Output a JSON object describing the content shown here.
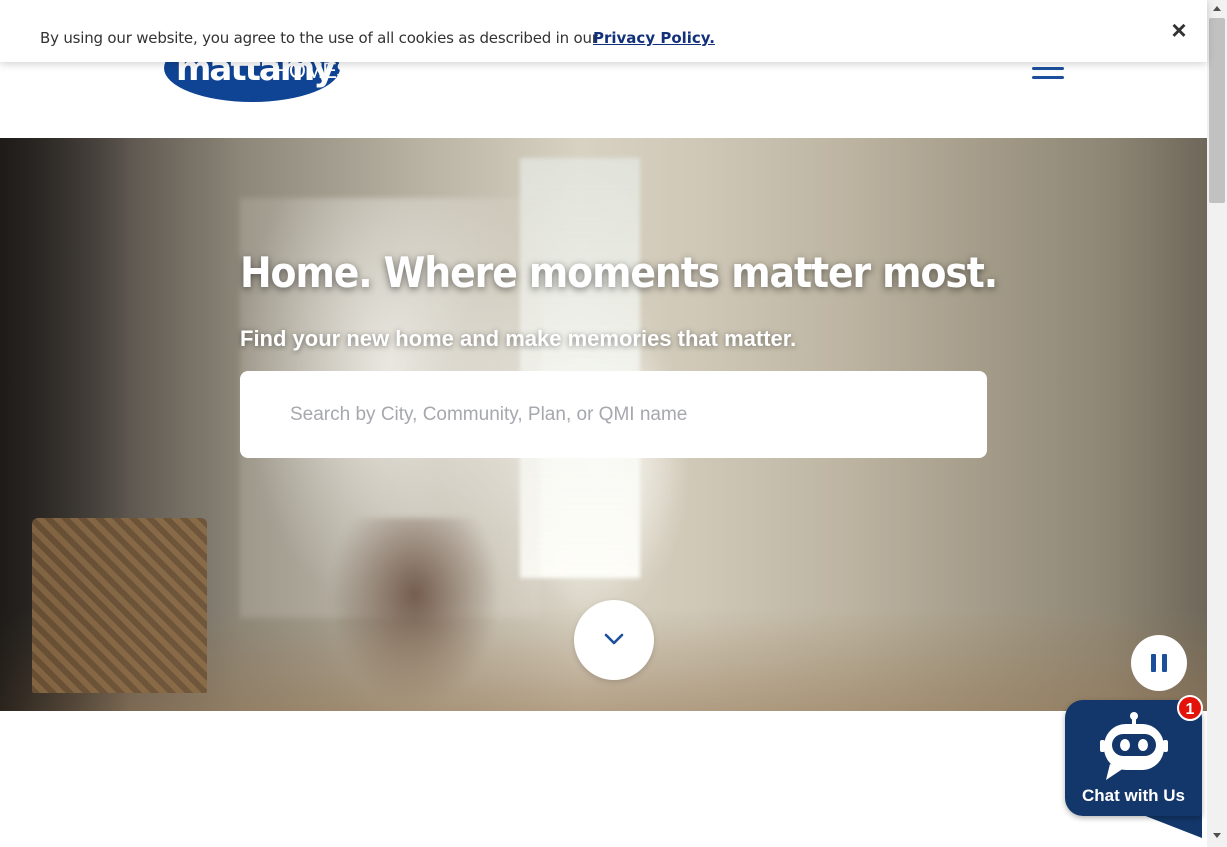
{
  "cookie_bar": {
    "message": "By using our website, you agree to the use of all cookies as described in our",
    "link_label": "Privacy Policy.",
    "close_icon": "close-icon"
  },
  "header": {
    "logo_text_main": "mattamy",
    "logo_text_sub": "HOMES",
    "menu_icon": "hamburger-menu-icon"
  },
  "hero": {
    "title": "Home. Where moments matter most.",
    "subtitle": "Find your new home and make memories that matter.",
    "search_placeholder": "Search by City, Community, Plan, or QMI name",
    "scroll_icon": "chevron-down-icon",
    "pause_icon": "pause-icon"
  },
  "chat": {
    "label": "Chat with Us",
    "badge_count": "1",
    "icon": "chat-bot-icon"
  },
  "colors": {
    "brand_blue": "#1b4f9c",
    "logo_blue": "#0f4393",
    "chat_navy": "#13376b",
    "badge_red": "#e3120b",
    "link_navy": "#13307a"
  }
}
